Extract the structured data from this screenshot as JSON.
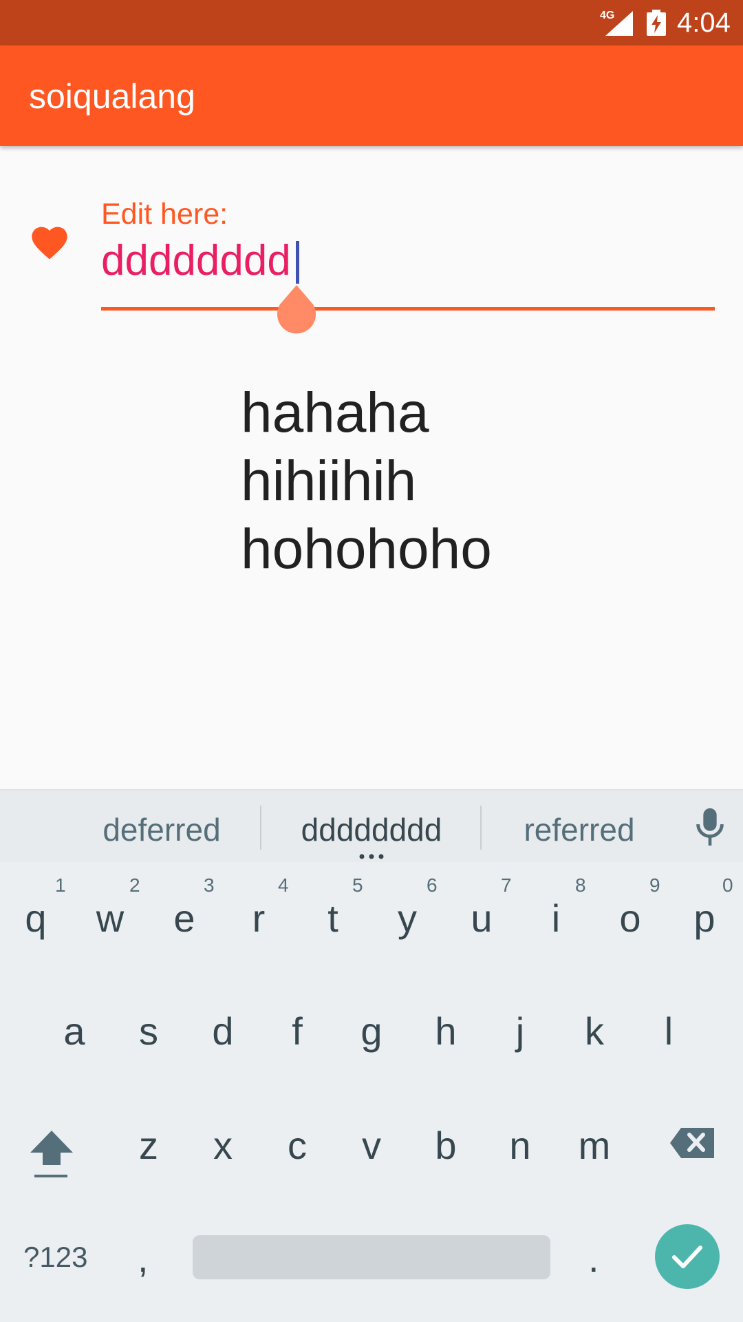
{
  "status_bar": {
    "network": "4G",
    "time": "4:04"
  },
  "app_bar": {
    "title": "soiqualang"
  },
  "form": {
    "label": "Edit here:",
    "value": "dddddddd"
  },
  "content": {
    "lines": [
      "hahaha",
      "hihiihih",
      "hohohoho"
    ]
  },
  "keyboard": {
    "suggestions": [
      "deferred",
      "dddddddd",
      "referred"
    ],
    "row1": [
      {
        "key": "q",
        "hint": "1"
      },
      {
        "key": "w",
        "hint": "2"
      },
      {
        "key": "e",
        "hint": "3"
      },
      {
        "key": "r",
        "hint": "4"
      },
      {
        "key": "t",
        "hint": "5"
      },
      {
        "key": "y",
        "hint": "6"
      },
      {
        "key": "u",
        "hint": "7"
      },
      {
        "key": "i",
        "hint": "8"
      },
      {
        "key": "o",
        "hint": "9"
      },
      {
        "key": "p",
        "hint": "0"
      }
    ],
    "row2": [
      "a",
      "s",
      "d",
      "f",
      "g",
      "h",
      "j",
      "k",
      "l"
    ],
    "row3": [
      "z",
      "x",
      "c",
      "v",
      "b",
      "n",
      "m"
    ],
    "symbols_label": "?123",
    "comma_label": ",",
    "period_label": "."
  },
  "colors": {
    "status_bar": "#bf431a",
    "app_bar": "#ff5722",
    "input_text": "#e91e63",
    "enter_key": "#4db6ac"
  },
  "icons": [
    "heart-icon",
    "microphone-icon",
    "shift-icon",
    "backspace-icon",
    "check-icon"
  ]
}
